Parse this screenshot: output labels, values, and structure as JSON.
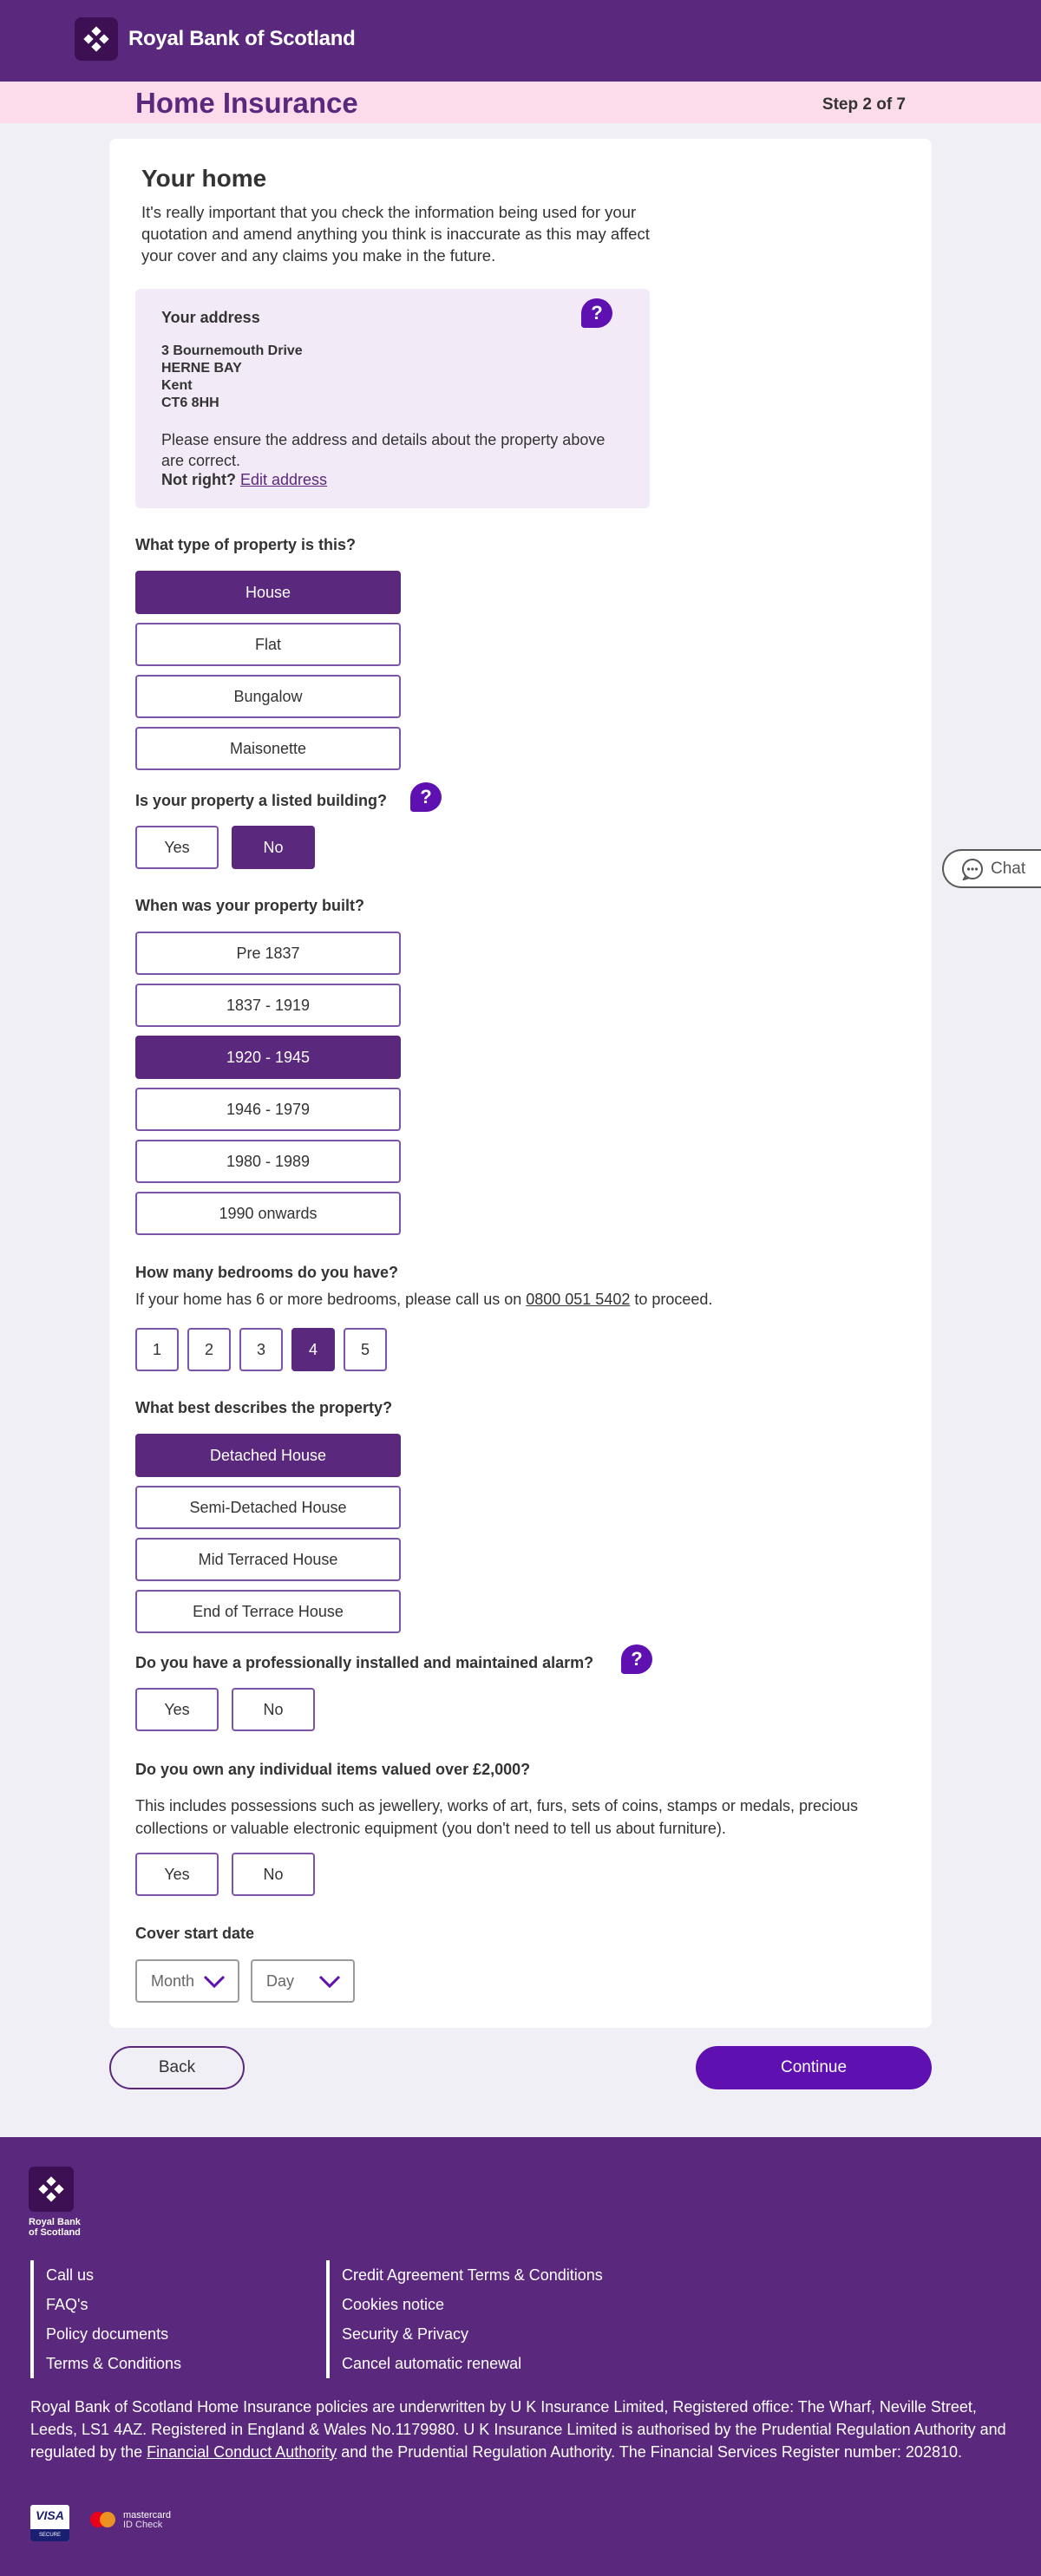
{
  "brand": {
    "name": "Royal Bank of Scotland",
    "footer_name_line1": "Royal Bank",
    "footer_name_line2": "of Scotland"
  },
  "header": {
    "title": "Home Insurance",
    "step": "Step 2 of 7"
  },
  "section": {
    "title": "Your home",
    "intro": "It's really important that you check the information being used for your quotation and amend anything you think is inaccurate as this may affect your cover and any claims you make in the future."
  },
  "address": {
    "title": "Your address",
    "lines": [
      "3 Bournemouth Drive",
      "HERNE BAY",
      "Kent",
      "CT6 8HH"
    ],
    "note": "Please ensure the address and details about the property above are correct.",
    "not_right": "Not right?",
    "edit_link": "Edit address"
  },
  "property_type": {
    "question": "What type of property is this?",
    "options": [
      "House",
      "Flat",
      "Bungalow",
      "Maisonette"
    ],
    "selected": "House"
  },
  "listed": {
    "question": "Is your property a listed building?",
    "options": [
      "Yes",
      "No"
    ],
    "selected": "No"
  },
  "built": {
    "question": "When was your property built?",
    "options": [
      "Pre 1837",
      "1837 - 1919",
      "1920 - 1945",
      "1946 - 1979",
      "1980 - 1989",
      "1990 onwards"
    ],
    "selected": "1920 - 1945"
  },
  "bedrooms": {
    "question": "How many bedrooms do you have?",
    "sub_before": "If your home has 6 or more bedrooms, please call us on ",
    "phone": "0800 051 5402",
    "sub_after": " to proceed.",
    "options": [
      "1",
      "2",
      "3",
      "4",
      "5"
    ],
    "selected": "4"
  },
  "describes": {
    "question": "What best describes the property?",
    "options": [
      "Detached House",
      "Semi-Detached House",
      "Mid Terraced House",
      "End of Terrace House"
    ],
    "selected": "Detached House"
  },
  "alarm": {
    "question": "Do you have a professionally installed and maintained alarm?",
    "options": [
      "Yes",
      "No"
    ]
  },
  "valuables": {
    "question": "Do you own any individual items valued over £2,000?",
    "sub": "This includes possessions such as jewellery, works of art, furs, sets of coins, stamps or medals, precious collections or valuable electronic equipment (you don't need to tell us about furniture).",
    "options": [
      "Yes",
      "No"
    ]
  },
  "cover": {
    "question": "Cover start date",
    "month_placeholder": "Month",
    "day_placeholder": "Day"
  },
  "help_label": "?",
  "chat": {
    "label": "Chat"
  },
  "nav": {
    "back": "Back",
    "continue": "Continue"
  },
  "footer": {
    "col1": [
      "Call us",
      "FAQ's",
      "Policy documents",
      "Terms & Conditions"
    ],
    "col2": [
      "Credit Agreement Terms & Conditions",
      "Cookies notice",
      "Security & Privacy",
      "Cancel automatic renewal"
    ],
    "legal_before": "Royal Bank of Scotland Home Insurance policies are underwritten by U K Insurance Limited, Registered office: The Wharf, Neville Street, Leeds, LS1 4AZ. Registered in England & Wales No.1179980. U K Insurance Limited is authorised by the Prudential Regulation Authority and regulated by the ",
    "legal_link": "Financial Conduct Authority",
    "legal_after": " and the Prudential Regulation Authority. The Financial Services Register number: 202810.",
    "visa": "VISA",
    "visa_secure": "SECURE",
    "mastercard": "mastercard",
    "mastercard_sub": "ID Check"
  },
  "colors": {
    "brand_purple": "#5a287d",
    "accent": "#5e10b1",
    "pink_bar": "#fcdcea",
    "address_bg": "#f2eaf6"
  }
}
